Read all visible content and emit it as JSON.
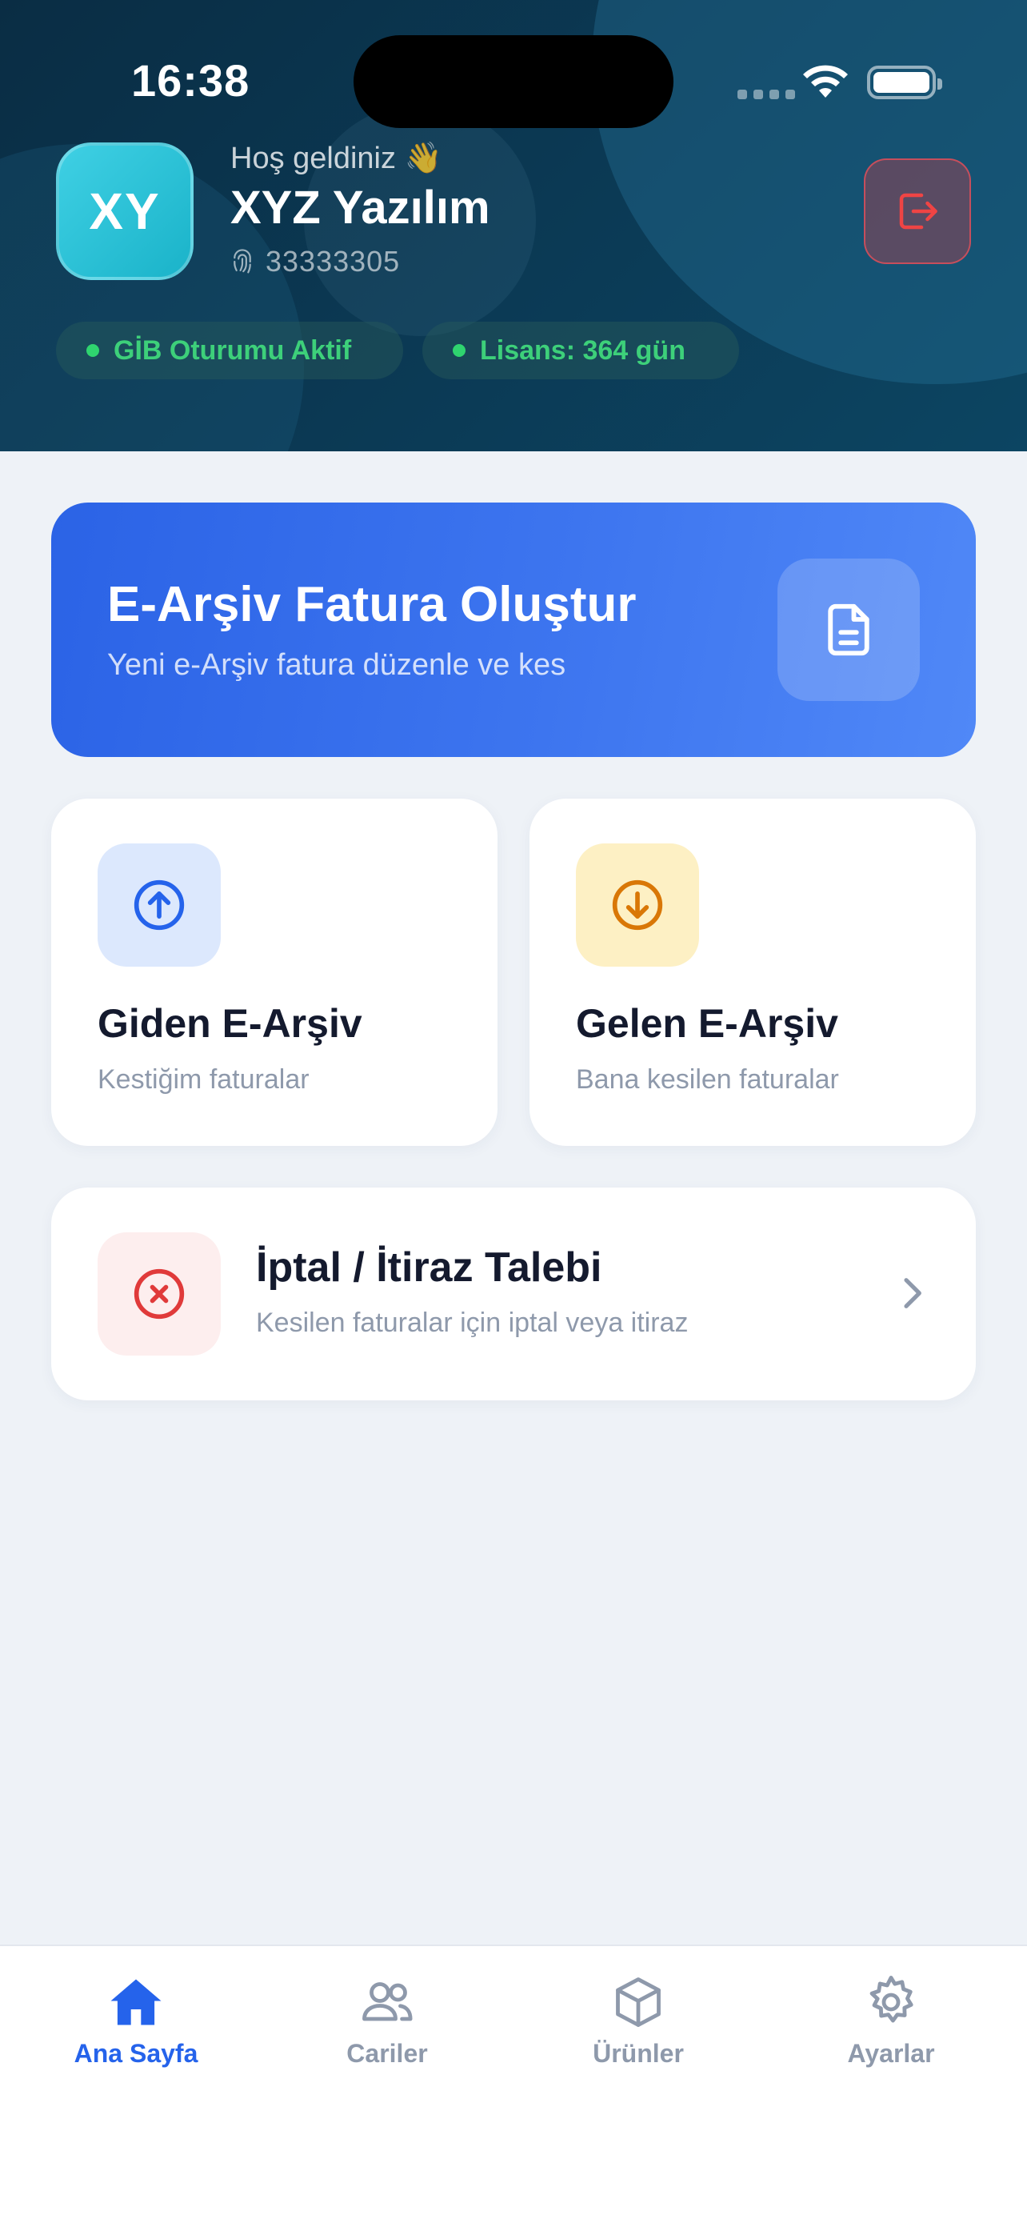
{
  "status_bar": {
    "time": "16:38"
  },
  "header": {
    "avatar_initials": "XY",
    "welcome": "Hoş geldiniz 👋",
    "company_name": "XYZ Yazılım",
    "tax_id": "33333305",
    "badges": [
      {
        "label": "GİB Oturumu Aktif",
        "color": "#2fd46f"
      },
      {
        "label": "Lisans: 364 gün",
        "color": "#2fd46f"
      }
    ]
  },
  "create_invoice": {
    "title": "E-Arşiv Fatura Oluştur",
    "subtitle": "Yeni e-Arşiv fatura düzenle ve kes",
    "icon": "document-icon"
  },
  "tiles": [
    {
      "title": "Giden E-Arşiv",
      "subtitle": "Kestiğim faturalar",
      "icon": "arrow-up-circle-icon",
      "color": "#2563eb"
    },
    {
      "title": "Gelen E-Arşiv",
      "subtitle": "Bana kesilen faturalar",
      "icon": "arrow-down-circle-icon",
      "color": "#d97706"
    }
  ],
  "cancel_card": {
    "title": "İptal / İtiraz Talebi",
    "subtitle": "Kesilen faturalar için iptal veya itiraz",
    "icon": "x-circle-icon",
    "color": "#e03a3a"
  },
  "tabbar": {
    "active": "Ana Sayfa",
    "items": [
      {
        "label": "Ana Sayfa",
        "icon": "home-icon"
      },
      {
        "label": "Cariler",
        "icon": "users-icon"
      },
      {
        "label": "Ürünler",
        "icon": "box-icon"
      },
      {
        "label": "Ayarlar",
        "icon": "gear-icon"
      }
    ]
  },
  "colors": {
    "accent": "#2563eb",
    "header_bg": "#0b3a55"
  }
}
